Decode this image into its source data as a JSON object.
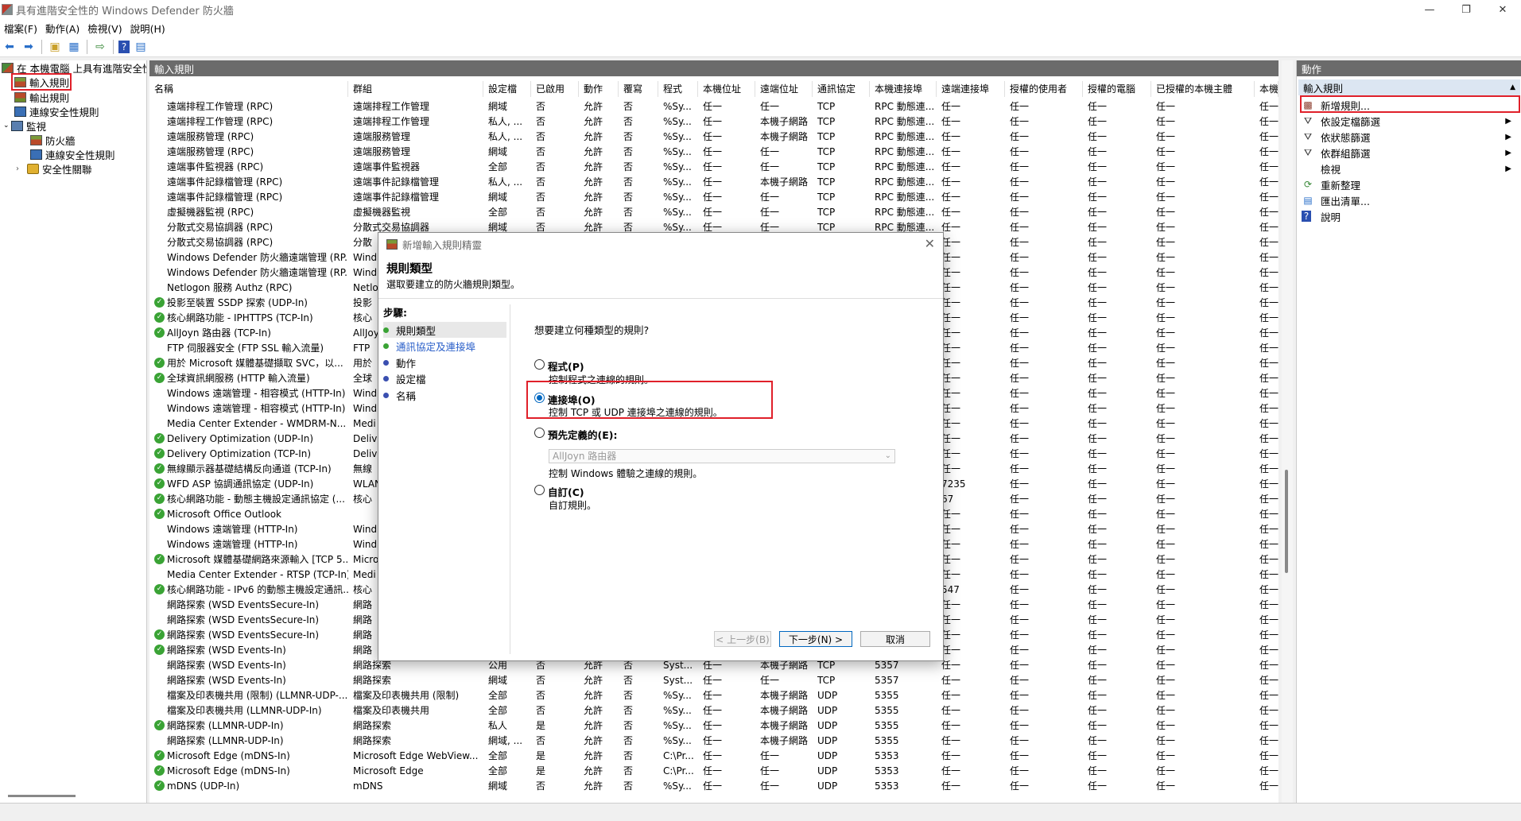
{
  "window": {
    "title": "具有進階安全性的 Windows Defender 防火牆",
    "controls": [
      "—",
      "❐",
      "✕"
    ]
  },
  "menu": [
    "檔案(F)",
    "動作(A)",
    "檢視(V)",
    "說明(H)"
  ],
  "tree": {
    "root": "在 本機電腦 上具有進階安全性...",
    "inbound": "輸入規則",
    "outbound": "輸出規則",
    "connsec": "連線安全性規則",
    "monitor": "監視",
    "mon_fw": "防火牆",
    "mon_connsec": "連線安全性規則",
    "mon_secassoc": "安全性關聯"
  },
  "center": {
    "header": "輸入規則",
    "columns": [
      "名稱",
      "群組",
      "設定檔",
      "已啟用",
      "動作",
      "覆寫",
      "程式",
      "本機位址",
      "遠端位址",
      "通訊協定",
      "本機連接埠",
      "遠端連接埠",
      "授權的使用者",
      "授權的電腦",
      "已授權的本機主體",
      "本機使"
    ],
    "rows": [
      {
        "on": false,
        "c": [
          "遠端排程工作管理 (RPC)",
          "遠端排程工作管理",
          "網域",
          "否",
          "允許",
          "否",
          "%Sy...",
          "任一",
          "任一",
          "TCP",
          "RPC 動態連...",
          "任一",
          "任一",
          "任一",
          "任一",
          "任一"
        ]
      },
      {
        "on": false,
        "c": [
          "遠端排程工作管理 (RPC)",
          "遠端排程工作管理",
          "私人, ...",
          "否",
          "允許",
          "否",
          "%Sy...",
          "任一",
          "本機子網路",
          "TCP",
          "RPC 動態連...",
          "任一",
          "任一",
          "任一",
          "任一",
          "任一"
        ]
      },
      {
        "on": false,
        "c": [
          "遠端服務管理 (RPC)",
          "遠端服務管理",
          "私人, ...",
          "否",
          "允許",
          "否",
          "%Sy...",
          "任一",
          "本機子網路",
          "TCP",
          "RPC 動態連...",
          "任一",
          "任一",
          "任一",
          "任一",
          "任一"
        ]
      },
      {
        "on": false,
        "c": [
          "遠端服務管理 (RPC)",
          "遠端服務管理",
          "網域",
          "否",
          "允許",
          "否",
          "%Sy...",
          "任一",
          "任一",
          "TCP",
          "RPC 動態連...",
          "任一",
          "任一",
          "任一",
          "任一",
          "任一"
        ]
      },
      {
        "on": false,
        "c": [
          "遠端事件監視器 (RPC)",
          "遠端事件監視器",
          "全部",
          "否",
          "允許",
          "否",
          "%Sy...",
          "任一",
          "任一",
          "TCP",
          "RPC 動態連...",
          "任一",
          "任一",
          "任一",
          "任一",
          "任一"
        ]
      },
      {
        "on": false,
        "c": [
          "遠端事件記錄檔管理 (RPC)",
          "遠端事件記錄檔管理",
          "私人, ...",
          "否",
          "允許",
          "否",
          "%Sy...",
          "任一",
          "本機子網路",
          "TCP",
          "RPC 動態連...",
          "任一",
          "任一",
          "任一",
          "任一",
          "任一"
        ]
      },
      {
        "on": false,
        "c": [
          "遠端事件記錄檔管理 (RPC)",
          "遠端事件記錄檔管理",
          "網域",
          "否",
          "允許",
          "否",
          "%Sy...",
          "任一",
          "任一",
          "TCP",
          "RPC 動態連...",
          "任一",
          "任一",
          "任一",
          "任一",
          "任一"
        ]
      },
      {
        "on": false,
        "c": [
          "虛擬機器監視 (RPC)",
          "虛擬機器監視",
          "全部",
          "否",
          "允許",
          "否",
          "%Sy...",
          "任一",
          "任一",
          "TCP",
          "RPC 動態連...",
          "任一",
          "任一",
          "任一",
          "任一",
          "任一"
        ]
      },
      {
        "on": false,
        "c": [
          "分散式交易協調器 (RPC)",
          "分散式交易協調器",
          "網域",
          "否",
          "允許",
          "否",
          "%Sy...",
          "任一",
          "任一",
          "TCP",
          "RPC 動態連...",
          "任一",
          "任一",
          "任一",
          "任一",
          "任一"
        ]
      },
      {
        "on": false,
        "c": [
          "分散式交易協調器 (RPC)",
          "分散",
          "",
          "",
          "",
          "",
          "",
          "",
          "",
          "",
          "",
          "任一",
          "任一",
          "任一",
          "任一",
          "任一"
        ]
      },
      {
        "on": false,
        "c": [
          "Windows Defender 防火牆遠端管理 (RP...",
          "Wind",
          "",
          "",
          "",
          "",
          "",
          "",
          "",
          "",
          "",
          "任一",
          "任一",
          "任一",
          "任一",
          "任一"
        ]
      },
      {
        "on": false,
        "c": [
          "Windows Defender 防火牆遠端管理 (RP...",
          "Wind",
          "",
          "",
          "",
          "",
          "",
          "",
          "",
          "",
          "",
          "任一",
          "任一",
          "任一",
          "任一",
          "任一"
        ]
      },
      {
        "on": false,
        "c": [
          "Netlogon 服務 Authz (RPC)",
          "Netlo",
          "",
          "",
          "",
          "",
          "",
          "",
          "",
          "",
          "",
          "任一",
          "任一",
          "任一",
          "任一",
          "任一"
        ]
      },
      {
        "on": true,
        "c": [
          "投影至裝置 SSDP 探索 (UDP-In)",
          "投影",
          "",
          "",
          "",
          "",
          "",
          "",
          "",
          "",
          "",
          "任一",
          "任一",
          "任一",
          "任一",
          "任一"
        ]
      },
      {
        "on": true,
        "c": [
          "核心網路功能 - IPHTTPS (TCP-In)",
          "核心",
          "",
          "",
          "",
          "",
          "",
          "",
          "",
          "",
          "",
          "任一",
          "任一",
          "任一",
          "任一",
          "任一"
        ]
      },
      {
        "on": true,
        "c": [
          "AllJoyn 路由器 (TCP-In)",
          "AllJoy",
          "",
          "",
          "",
          "",
          "",
          "",
          "",
          "",
          "",
          "任一",
          "任一",
          "任一",
          "任一",
          "任一"
        ]
      },
      {
        "on": false,
        "c": [
          "FTP 伺服器安全 (FTP SSL 輸入流量)",
          "FTP ",
          "",
          "",
          "",
          "",
          "",
          "",
          "",
          "",
          "",
          "任一",
          "任一",
          "任一",
          "任一",
          "任一"
        ]
      },
      {
        "on": true,
        "c": [
          "用於 Microsoft 媒體基礎擷取 SVC，以...",
          "用於",
          "",
          "",
          "",
          "",
          "",
          "",
          "",
          "",
          "",
          "任一",
          "任一",
          "任一",
          "任一",
          "任一"
        ]
      },
      {
        "on": true,
        "c": [
          "全球資訊網服務 (HTTP 輸入流量)",
          "全球",
          "",
          "",
          "",
          "",
          "",
          "",
          "",
          "",
          "",
          "任一",
          "任一",
          "任一",
          "任一",
          "任一"
        ]
      },
      {
        "on": false,
        "c": [
          "Windows 遠端管理 - 相容模式 (HTTP-In)",
          "Wind",
          "",
          "",
          "",
          "",
          "",
          "",
          "",
          "",
          "",
          "任一",
          "任一",
          "任一",
          "任一",
          "任一"
        ]
      },
      {
        "on": false,
        "c": [
          "Windows 遠端管理 - 相容模式 (HTTP-In)",
          "Wind",
          "",
          "",
          "",
          "",
          "",
          "",
          "",
          "",
          "",
          "任一",
          "任一",
          "任一",
          "任一",
          "任一"
        ]
      },
      {
        "on": false,
        "c": [
          "Media Center Extender - WMDRM-N...",
          "Medi",
          "",
          "",
          "",
          "",
          "",
          "",
          "",
          "",
          "",
          "任一",
          "任一",
          "任一",
          "任一",
          "任一"
        ]
      },
      {
        "on": true,
        "c": [
          "Delivery Optimization (UDP-In)",
          "Deliv",
          "",
          "",
          "",
          "",
          "",
          "",
          "",
          "",
          "",
          "任一",
          "任一",
          "任一",
          "任一",
          "任一"
        ]
      },
      {
        "on": true,
        "c": [
          "Delivery Optimization (TCP-In)",
          "Deliv",
          "",
          "",
          "",
          "",
          "",
          "",
          "",
          "",
          "",
          "任一",
          "任一",
          "任一",
          "任一",
          "任一"
        ]
      },
      {
        "on": true,
        "c": [
          "無線顯示器基礎結構反向通道 (TCP-In)",
          "無線",
          "",
          "",
          "",
          "",
          "",
          "",
          "",
          "",
          "",
          "任一",
          "任一",
          "任一",
          "任一",
          "任一"
        ]
      },
      {
        "on": true,
        "c": [
          "WFD ASP 協調通訊協定 (UDP-In)",
          "WLAN",
          "",
          "",
          "",
          "",
          "",
          "",
          "",
          "",
          "",
          "7235",
          "任一",
          "任一",
          "任一",
          "任一"
        ]
      },
      {
        "on": true,
        "c": [
          "核心網路功能 - 動態主機設定通訊協定 (...",
          "核心",
          "",
          "",
          "",
          "",
          "",
          "",
          "",
          "",
          "",
          "67",
          "任一",
          "任一",
          "任一",
          "任一"
        ]
      },
      {
        "on": true,
        "c": [
          "Microsoft Office Outlook",
          "",
          "",
          "",
          "",
          "",
          "",
          "",
          "",
          "",
          "",
          "任一",
          "任一",
          "任一",
          "任一",
          "任一"
        ]
      },
      {
        "on": false,
        "c": [
          "Windows 遠端管理 (HTTP-In)",
          "Wind",
          "",
          "",
          "",
          "",
          "",
          "",
          "",
          "",
          "",
          "任一",
          "任一",
          "任一",
          "任一",
          "任一"
        ]
      },
      {
        "on": false,
        "c": [
          "Windows 遠端管理 (HTTP-In)",
          "Wind",
          "",
          "",
          "",
          "",
          "",
          "",
          "",
          "",
          "",
          "任一",
          "任一",
          "任一",
          "任一",
          "任一"
        ]
      },
      {
        "on": true,
        "c": [
          "Microsoft 媒體基礎網路來源輸入 [TCP 5...",
          "Micro",
          "",
          "",
          "",
          "",
          "",
          "",
          "",
          "",
          "",
          "任一",
          "任一",
          "任一",
          "任一",
          "任一"
        ]
      },
      {
        "on": false,
        "c": [
          "Media Center Extender - RTSP (TCP-In)",
          "Medi",
          "",
          "",
          "",
          "",
          "",
          "",
          "",
          "",
          "",
          "任一",
          "任一",
          "任一",
          "任一",
          "任一"
        ]
      },
      {
        "on": true,
        "c": [
          "核心網路功能 - IPv6 的動態主機設定通訊...",
          "核心",
          "",
          "",
          "",
          "",
          "",
          "",
          "",
          "",
          "",
          "547",
          "任一",
          "任一",
          "任一",
          "任一"
        ]
      },
      {
        "on": false,
        "c": [
          "網路探索 (WSD EventsSecure-In)",
          "網路",
          "",
          "",
          "",
          "",
          "",
          "",
          "",
          "",
          "",
          "任一",
          "任一",
          "任一",
          "任一",
          "任一"
        ]
      },
      {
        "on": false,
        "c": [
          "網路探索 (WSD EventsSecure-In)",
          "網路",
          "",
          "",
          "",
          "",
          "",
          "",
          "",
          "",
          "",
          "任一",
          "任一",
          "任一",
          "任一",
          "任一"
        ]
      },
      {
        "on": true,
        "c": [
          "網路探索 (WSD EventsSecure-In)",
          "網路",
          "",
          "",
          "",
          "",
          "",
          "",
          "",
          "",
          "",
          "任一",
          "任一",
          "任一",
          "任一",
          "任一"
        ]
      },
      {
        "on": true,
        "c": [
          "網路探索 (WSD Events-In)",
          "網路",
          "",
          "",
          "",
          "",
          "",
          "",
          "",
          "",
          "",
          "任一",
          "任一",
          "任一",
          "任一",
          "任一"
        ]
      },
      {
        "on": false,
        "c": [
          "網路探索 (WSD Events-In)",
          "網路探索",
          "公用",
          "否",
          "允許",
          "否",
          "Syst...",
          "任一",
          "本機子網路",
          "TCP",
          "5357",
          "任一",
          "任一",
          "任一",
          "任一",
          "任一"
        ]
      },
      {
        "on": false,
        "c": [
          "網路探索 (WSD Events-In)",
          "網路探索",
          "網域",
          "否",
          "允許",
          "否",
          "Syst...",
          "任一",
          "任一",
          "TCP",
          "5357",
          "任一",
          "任一",
          "任一",
          "任一",
          "任一"
        ]
      },
      {
        "on": false,
        "c": [
          "檔案及印表機共用 (限制) (LLMNR-UDP-...",
          "檔案及印表機共用 (限制)",
          "全部",
          "否",
          "允許",
          "否",
          "%Sy...",
          "任一",
          "本機子網路",
          "UDP",
          "5355",
          "任一",
          "任一",
          "任一",
          "任一",
          "任一"
        ]
      },
      {
        "on": false,
        "c": [
          "檔案及印表機共用 (LLMNR-UDP-In)",
          "檔案及印表機共用",
          "全部",
          "否",
          "允許",
          "否",
          "%Sy...",
          "任一",
          "本機子網路",
          "UDP",
          "5355",
          "任一",
          "任一",
          "任一",
          "任一",
          "任一"
        ]
      },
      {
        "on": true,
        "c": [
          "網路探索 (LLMNR-UDP-In)",
          "網路探索",
          "私人",
          "是",
          "允許",
          "否",
          "%Sy...",
          "任一",
          "本機子網路",
          "UDP",
          "5355",
          "任一",
          "任一",
          "任一",
          "任一",
          "任一"
        ]
      },
      {
        "on": false,
        "c": [
          "網路探索 (LLMNR-UDP-In)",
          "網路探索",
          "網域, ...",
          "否",
          "允許",
          "否",
          "%Sy...",
          "任一",
          "本機子網路",
          "UDP",
          "5355",
          "任一",
          "任一",
          "任一",
          "任一",
          "任一"
        ]
      },
      {
        "on": true,
        "c": [
          "Microsoft Edge (mDNS-In)",
          "Microsoft Edge WebView...",
          "全部",
          "是",
          "允許",
          "否",
          "C:\\Pr...",
          "任一",
          "任一",
          "UDP",
          "5353",
          "任一",
          "任一",
          "任一",
          "任一",
          "任一"
        ]
      },
      {
        "on": true,
        "c": [
          "Microsoft Edge (mDNS-In)",
          "Microsoft Edge",
          "全部",
          "是",
          "允許",
          "否",
          "C:\\Pr...",
          "任一",
          "任一",
          "UDP",
          "5353",
          "任一",
          "任一",
          "任一",
          "任一",
          "任一"
        ]
      },
      {
        "on": true,
        "c": [
          "mDNS (UDP-In)",
          "mDNS",
          "網域",
          "否",
          "允許",
          "否",
          "%Sy...",
          "任一",
          "任一",
          "UDP",
          "5353",
          "任一",
          "任一",
          "任一",
          "任一",
          "任一"
        ]
      }
    ]
  },
  "actions": {
    "header": "動作",
    "section": "輸入規則",
    "items": [
      {
        "label": "新增規則...",
        "icon": "new-rule-icon",
        "arrow": false
      },
      {
        "label": "依設定檔篩選",
        "icon": "filter-icon",
        "arrow": true
      },
      {
        "label": "依狀態篩選",
        "icon": "filter-icon",
        "arrow": true
      },
      {
        "label": "依群組篩選",
        "icon": "filter-icon",
        "arrow": true
      },
      {
        "label": "檢視",
        "icon": "",
        "arrow": true
      },
      {
        "label": "重新整理",
        "icon": "refresh-icon",
        "arrow": false
      },
      {
        "label": "匯出清單...",
        "icon": "export-icon",
        "arrow": false
      },
      {
        "label": "說明",
        "icon": "help-icon",
        "arrow": false
      }
    ]
  },
  "dialog": {
    "title": "新增輸入規則精靈",
    "heading": "規則類型",
    "subtitle": "選取要建立的防火牆規則類型。",
    "steps_title": "步驟:",
    "steps": [
      {
        "label": "規則類型",
        "color": "#3aa335"
      },
      {
        "label": "通訊協定及連接埠",
        "color": "#3aa335"
      },
      {
        "label": "動作",
        "color": "#3a4fb0"
      },
      {
        "label": "設定檔",
        "color": "#3a4fb0"
      },
      {
        "label": "名稱",
        "color": "#3a4fb0"
      }
    ],
    "question": "想要建立何種類型的規則?",
    "options": [
      {
        "label": "程式(P)",
        "desc": "控制程式之連線的規則。",
        "selected": false
      },
      {
        "label": "連接埠(O)",
        "desc": "控制 TCP 或 UDP 連接埠之連線的規則。",
        "selected": true
      },
      {
        "label": "預先定義的(E):",
        "desc": "控制 Windows 體驗之連線的規則。",
        "selected": false
      },
      {
        "label": "自訂(C)",
        "desc": "自訂規則。",
        "selected": false
      }
    ],
    "predefined_value": "AllJoyn 路由器",
    "back": "< 上一步(B)",
    "next": "下一步(N) >",
    "cancel": "取消",
    "close": "✕"
  }
}
